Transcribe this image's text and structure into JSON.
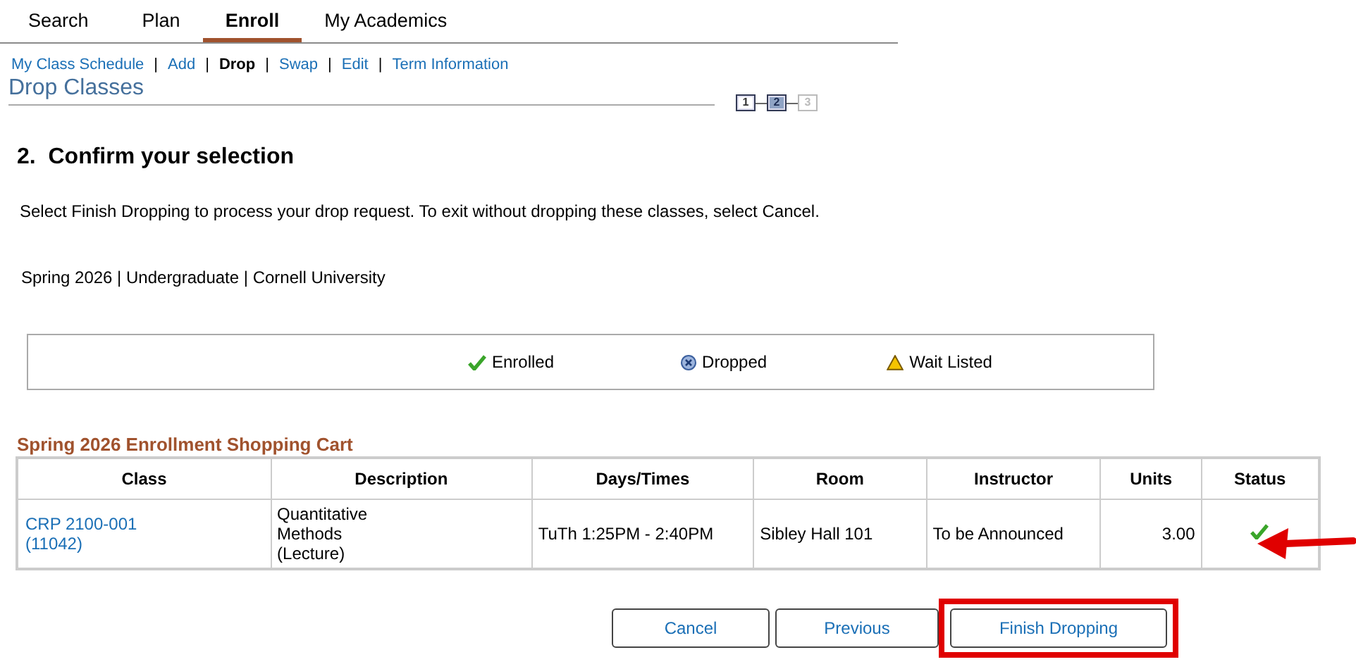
{
  "tabs": [
    {
      "label": "Search",
      "selected": false
    },
    {
      "label": "Plan",
      "selected": false
    },
    {
      "label": "Enroll",
      "selected": true
    },
    {
      "label": "My Academics",
      "selected": false
    }
  ],
  "subnav": [
    {
      "label": "My Class Schedule",
      "selected": false
    },
    {
      "separator_before": "|",
      "label": "Add",
      "selected": false
    },
    {
      "separator_before": "|",
      "label": "Drop",
      "selected": true
    },
    {
      "separator_before": "|",
      "label": "Swap",
      "selected": false
    },
    {
      "separator_before": "|",
      "label": "Edit",
      "selected": false
    },
    {
      "separator_before": "|",
      "label": "Term Information",
      "selected": false
    }
  ],
  "page_title": "Drop Classes",
  "steps": [
    {
      "label": "1",
      "selected": false,
      "disabled": false
    },
    {
      "label": "2",
      "selected": true,
      "disabled": false
    },
    {
      "label": "3",
      "selected": false,
      "disabled": true
    }
  ],
  "step_heading": "2.  Confirm your selection",
  "instructions": "Select Finish Dropping to process your drop request. To exit without dropping these classes, select Cancel.",
  "term": "Spring 2026 | Undergraduate | Cornell University",
  "legend": [
    {
      "kind": "enrolled",
      "label": "Enrolled"
    },
    {
      "kind": "dropped",
      "label": "Dropped"
    },
    {
      "kind": "waitlisted",
      "label": "Wait Listed"
    }
  ],
  "cart": {
    "title": "Spring 2026 Enrollment Shopping Cart",
    "columns": [
      "Class",
      "Description",
      "Days/Times",
      "Room",
      "Instructor",
      "Units",
      "Status"
    ],
    "rows": [
      {
        "class_lines": [
          "CRP 2100-001",
          "(11042)"
        ],
        "description_lines": [
          "Quantitative",
          "Methods",
          "(Lecture)"
        ],
        "days_times": "TuTh 1:25PM - 2:40PM",
        "room": "Sibley Hall 101",
        "instructor": "To be Announced",
        "units": "3.00",
        "kind": "enrolled",
        "pointed_at": true
      }
    ]
  },
  "buttons": [
    {
      "label": "Cancel",
      "highlighted": false
    },
    {
      "label": "Previous",
      "highlighted": false
    },
    {
      "label": "Finish Dropping",
      "highlighted": true
    }
  ]
}
